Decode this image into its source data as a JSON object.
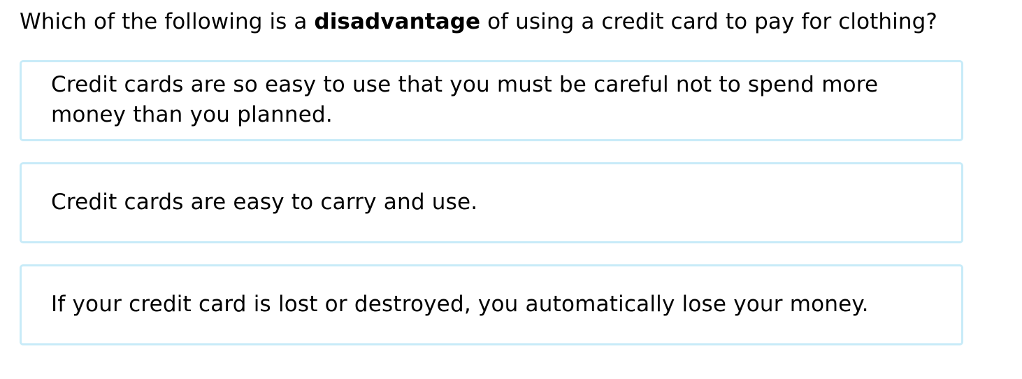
{
  "question": {
    "prefix": "Which of the following is a ",
    "emphasis": "disadvantage",
    "suffix": " of using a credit card to pay for clothing?"
  },
  "choices": [
    {
      "text": "Credit cards are so easy to use that you must be careful not to spend more money than you planned."
    },
    {
      "text": "Credit cards are easy to carry and use."
    },
    {
      "text": "If your credit card is lost or destroyed, you automatically lose your money."
    }
  ],
  "colors": {
    "choice_border": "#c8ebf8",
    "text": "#000000",
    "background": "#ffffff"
  }
}
